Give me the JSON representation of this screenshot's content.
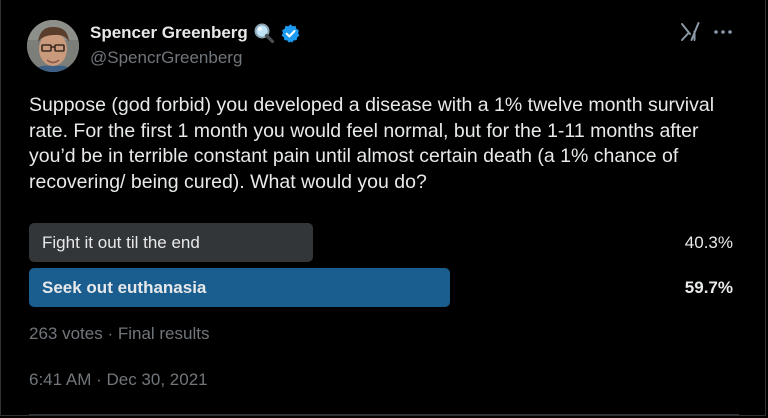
{
  "author": {
    "display_name": "Spencer Greenberg",
    "handle": "@SpencrGreenberg",
    "avatar_icon": "avatar-photo",
    "name_icons": [
      "magnifier-emoji-icon",
      "verified-badge-icon"
    ],
    "verified_color": "#1d9bf0"
  },
  "actions": {
    "grok_icon": "grok-icon",
    "more_icon": "more-icon"
  },
  "tweet": {
    "text": "Suppose (god forbid) you developed a disease with a 1% twelve month survival rate. For the first 1 month you would feel normal, but for the 1-11 months after you’d be in terrible constant pain until almost certain death (a 1% chance of recovering/ being cured). What would you do?"
  },
  "poll": {
    "options": [
      {
        "label": "Fight it out til the end",
        "percent_text": "40.3%",
        "percent": 40.3,
        "winner": false,
        "color": "#333639"
      },
      {
        "label": "Seek out euthanasia",
        "percent_text": "59.7%",
        "percent": 59.7,
        "winner": true,
        "color": "#1a5d8f"
      }
    ],
    "meta": "263 votes · Final results"
  },
  "timestamp": "6:41 AM · Dec 30, 2021"
}
